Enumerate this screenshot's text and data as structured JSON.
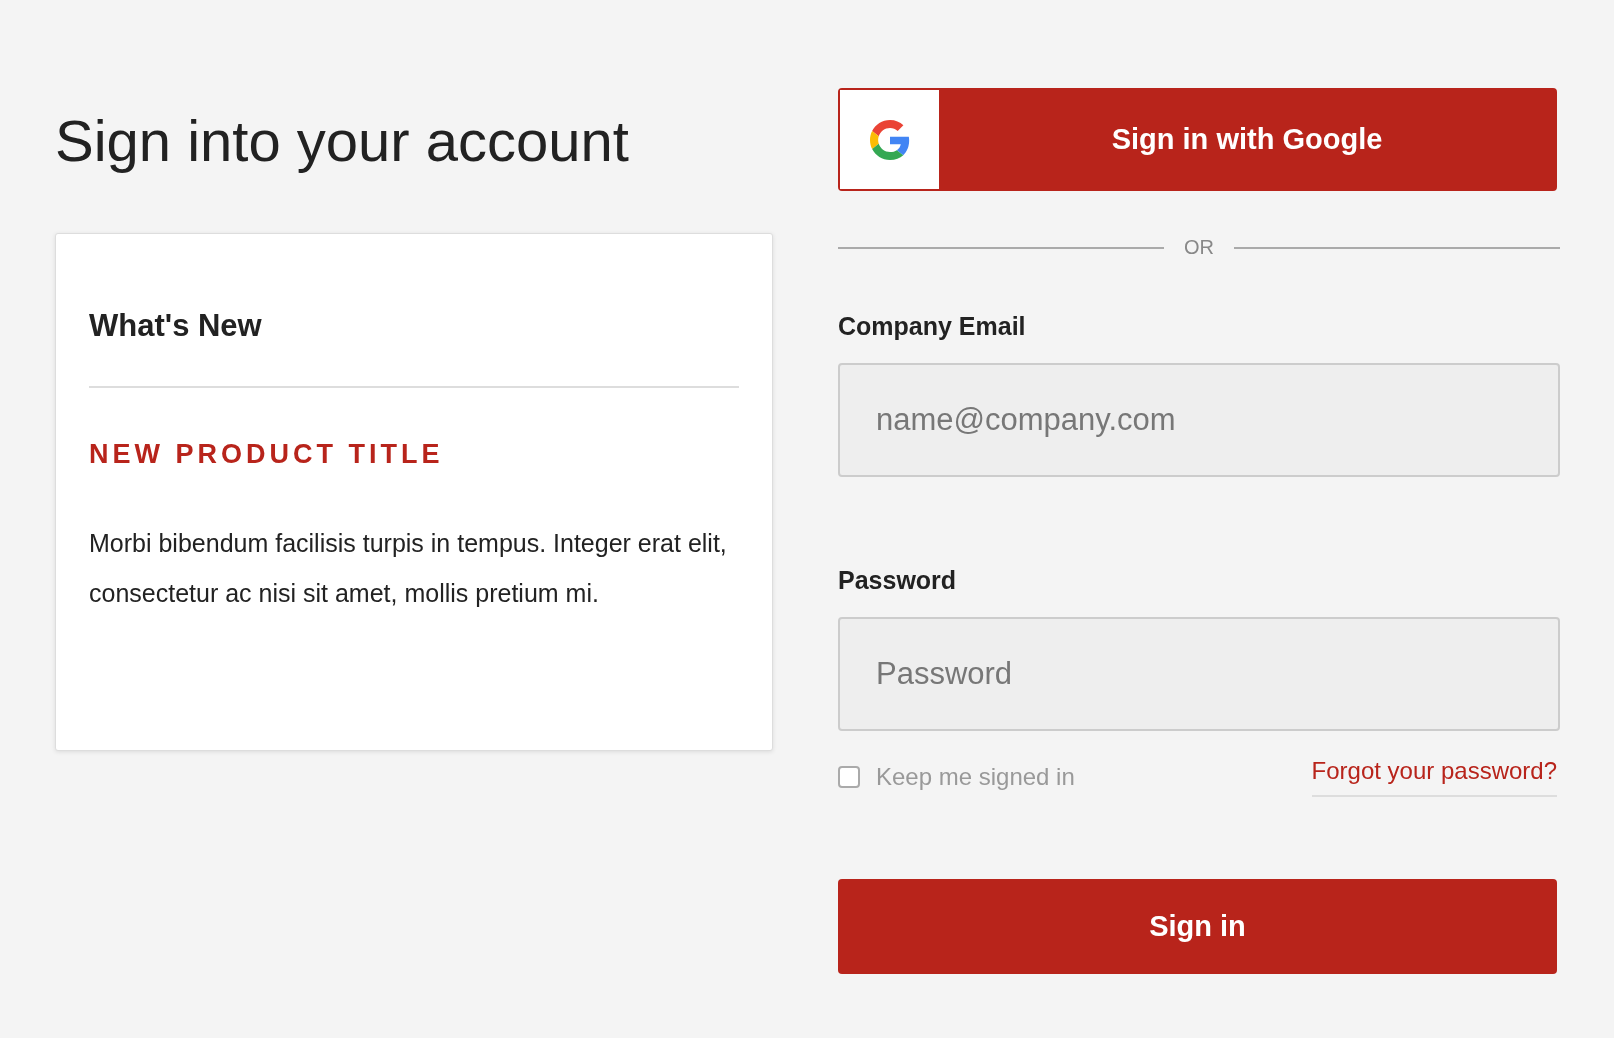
{
  "heading": "Sign into your account",
  "whats_new": {
    "title": "What's New",
    "product_title": "NEW PRODUCT TITLE",
    "body": "Morbi bibendum facilisis turpis in tempus. Integer erat elit, consectetur ac nisi sit amet, mollis pretium mi."
  },
  "google_button": {
    "label": "Sign in with Google"
  },
  "divider_text": "OR",
  "email": {
    "label": "Company Email",
    "placeholder": "name@company.com"
  },
  "password": {
    "label": "Password",
    "placeholder": "Password"
  },
  "keep_signed_in": {
    "label": "Keep me signed in",
    "checked": false
  },
  "forgot_link": "Forgot your password?",
  "submit": "Sign in"
}
